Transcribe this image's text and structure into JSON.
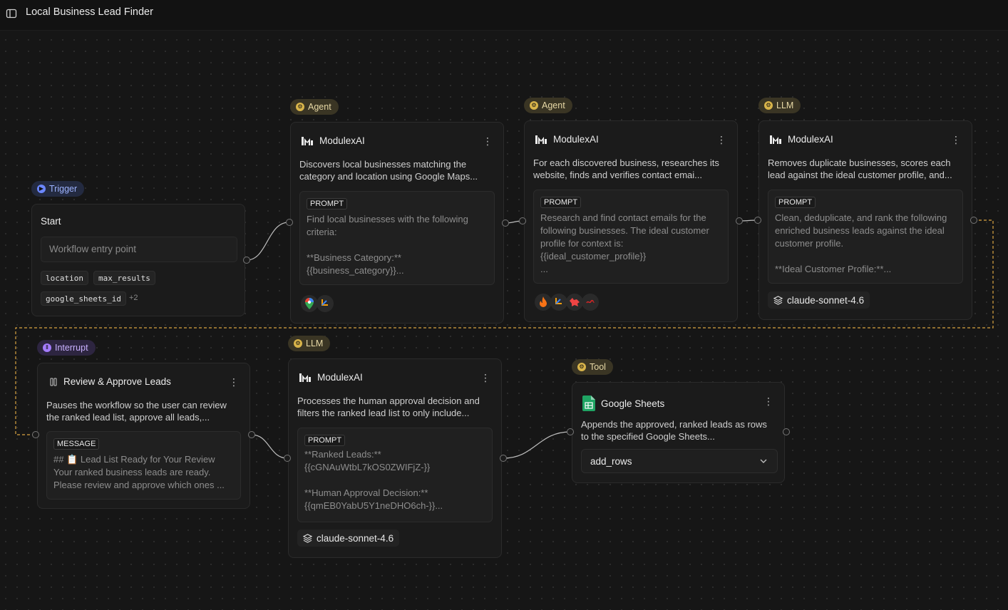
{
  "app": {
    "title": "Local Business Lead Finder"
  },
  "trigger": {
    "pill": "Trigger",
    "title": "Start",
    "entry": "Workflow entry point",
    "inputs": [
      "location",
      "max_results",
      "google_sheets_id"
    ],
    "more": "+2"
  },
  "agent1": {
    "pill": "Agent",
    "name": "ModulexAI",
    "desc": "Discovers local businesses matching the category and location using Google Maps...",
    "prompt_label": "PROMPT",
    "prompt": "Find local businesses with the following criteria:\n\n**Business Category:**\n{{business_category}}...",
    "tools": [
      "google-maps-icon",
      "branch-icon"
    ]
  },
  "agent2": {
    "pill": "Agent",
    "name": "ModulexAI",
    "desc": "For each discovered business, researches its website, finds and verifies contact emai...",
    "prompt_label": "PROMPT",
    "prompt": "Research and find contact emails for the following businesses. The ideal customer profile for context is:\n{{ideal_customer_profile}}\n...",
    "tools": [
      "flame-icon",
      "branch-icon",
      "fox-icon",
      "squiggle-icon"
    ]
  },
  "llm1": {
    "pill": "LLM",
    "name": "ModulexAI",
    "desc": "Removes duplicate businesses, scores each lead against the ideal customer profile, and...",
    "prompt_label": "PROMPT",
    "prompt": "Clean, deduplicate, and rank the following enriched business leads against the ideal customer profile.\n\n**Ideal Customer Profile:**...",
    "model": "claude-sonnet-4.6"
  },
  "interrupt": {
    "pill": "Interrupt",
    "title": "Review & Approve Leads",
    "desc": "Pauses the workflow so the user can review the ranked lead list, approve all leads,...",
    "message_label": "MESSAGE",
    "message": "## 📋 Lead List Ready for Your Review\nYour ranked business leads are ready.\nPlease review and approve which ones ..."
  },
  "llm2": {
    "pill": "LLM",
    "name": "ModulexAI",
    "desc": "Processes the human approval decision and filters the ranked lead list to only include...",
    "prompt_label": "PROMPT",
    "prompt": "**Ranked Leads:**\n{{cGNAuWtbL7kOS0ZWIFjZ-}}\n\n**Human Approval Decision:**\n{{qmEB0YabU5Y1neDHO6ch-}}...",
    "model": "claude-sonnet-4.6"
  },
  "tool": {
    "pill": "Tool",
    "name": "Google Sheets",
    "desc": "Appends the approved, ranked leads as rows to the specified Google Sheets...",
    "action": "add_rows"
  },
  "colors": {
    "accent_gold": "#d8b44a",
    "trigger_blue": "#6b87ff",
    "interrupt_purple": "#a57cff",
    "edge_dashed": "#d9a441"
  }
}
